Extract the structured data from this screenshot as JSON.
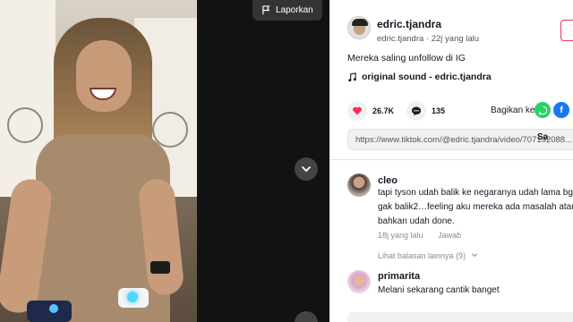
{
  "video": {
    "report_label": "Laporkan"
  },
  "author": {
    "username": "edric.tjandra",
    "handle": "edric.tjandra",
    "separator": "·",
    "posted": "22j yang lalu"
  },
  "post": {
    "caption": "Mereka saling unfollow di IG",
    "sound": "original sound - edric.tjandra"
  },
  "stats": {
    "likes": "26.7K",
    "comments": "135",
    "share_label": "Bagikan ke"
  },
  "share": {
    "colors": {
      "whatsapp": "#25d366",
      "facebook": "#1877f2"
    }
  },
  "link": {
    "url": "https://www.tiktok.com/@edric.tjandra/video/707192088...",
    "copy_label": "Sa"
  },
  "comments": [
    {
      "name": "cleo",
      "lines": [
        "tapi tyson udah balik ke negaranya udah lama bg",
        "gak balik2…feeling aku mereka ada masalah atau",
        "bahkan udah done."
      ],
      "time": "18j yang lalu",
      "reply_label": "Jawab",
      "more_replies": "Lihat balasan lainnya (9)"
    },
    {
      "name": "primarita",
      "lines": [
        "Melani sekarang cantik banget"
      ]
    }
  ]
}
